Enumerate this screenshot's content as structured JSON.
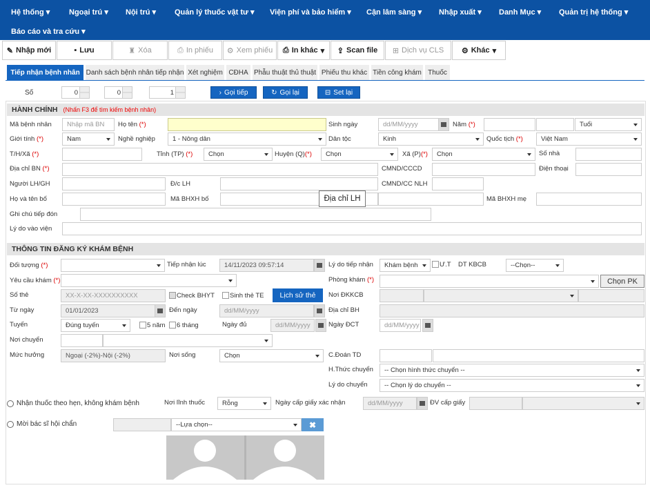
{
  "nav": {
    "row1": [
      "Hệ thống",
      "Ngoại trú",
      "Nội trú",
      "Quản lý thuốc vật tư",
      "Viện phí và bảo hiểm",
      "Cận lâm sàng",
      "Nhập xuất",
      "Danh Mục",
      "Quản trị hệ thống"
    ],
    "row2": [
      "Báo cáo và tra cứu"
    ]
  },
  "toolbar": [
    "Nhập mới",
    "Lưu",
    "Xóa",
    "In phiếu",
    "Xem phiếu",
    "In khác",
    "Scan file",
    "Dịch vụ CLS",
    "Khác"
  ],
  "tabs": [
    "Tiếp nhận bệnh nhân",
    "Danh sách bệnh nhân tiếp nhận",
    "Xét nghiệm",
    "CĐHA",
    "Phẫu thuật thủ thuật",
    "Phiếu thu khác",
    "Tiền công khám",
    "Thuốc"
  ],
  "counter": {
    "label": "Số",
    "values": [
      "0",
      "0",
      "1"
    ],
    "call_next": "Gọi tiếp",
    "recall": "Gọi lại",
    "reset": "Set lại"
  },
  "hanh_chinh": {
    "title": "HÀNH CHÍNH",
    "hint": "(Nhấn F3 để tìm kiếm bệnh nhân)",
    "ma_bn_label": "Mã bệnh nhân",
    "ma_bn_placeholder": "Nhập mã BN",
    "ho_ten_label": "Họ tên",
    "sinh_ngay_label": "Sinh ngày",
    "sinh_ngay_placeholder": "dd/MM/yyyy",
    "nam_label": "Năm",
    "tuoi_value": "Tuổi",
    "gioi_tinh_label": "Giới tính",
    "gioi_tinh_value": "Nam",
    "nghe_nghiep_label": "Nghề nghiệp",
    "nghe_nghiep_value": "1 - Nông dân",
    "dan_toc_label": "Dân tộc",
    "dan_toc_value": "Kinh",
    "quoc_tich_label": "Quốc tịch",
    "quoc_tich_value": "Việt Nam",
    "thx_label": "T/H/Xã",
    "tinh_label": "Tỉnh (TP)",
    "tinh_value": "Chọn",
    "huyen_label": "Huyện (Q)",
    "huyen_value": "Chọn",
    "xa_label": "Xã (P)",
    "xa_value": "Chọn",
    "so_nha_label": "Số nhà",
    "dia_chi_label": "Địa chỉ BN",
    "cmnd_label": "CMND/CCCD",
    "dien_thoai_label": "Điện thoại",
    "nguoi_lh_label": "Người LH/GH",
    "dc_lh_label": "Đ/c LH",
    "cmnd_nlh_label": "CMND/CC NLH",
    "ho_ten_bo_label": "Họ và tên bố",
    "ma_bhxh_bo_label": "Mã BHXH bố",
    "tooltip": "Địa chỉ LH",
    "ma_bhxh_me_label": "Mã BHXH mẹ",
    "ghi_chu_label": "Ghi chú tiếp đón",
    "ly_do_label": "Lý do vào viện"
  },
  "dang_ky": {
    "title": "THÔNG TIN ĐĂNG KÝ KHÁM BỆNH",
    "doi_tuong_label": "Đối tượng",
    "tiep_nhan_luc_label": "Tiếp nhận lúc",
    "tiep_nhan_luc_value": "14/11/2023 09:57:14",
    "ly_do_tn_label": "Lý do tiếp nhận",
    "ly_do_tn_value": "Khám bệnh",
    "ut_label": "Ư.T",
    "dt_kbcb_label": "DT KBCB",
    "dt_kbcb_value": "--Chọn--",
    "yeu_cau_label": "Yêu cầu khám",
    "phong_kham_label": "Phòng khám",
    "chon_pk": "Chọn PK",
    "so_the_label": "Số thẻ",
    "so_the_placeholder": "XX-X-XX-XXXXXXXXXX",
    "check_bhyt": "Check BHYT",
    "sinh_the_te": "Sinh thẻ TE",
    "lich_su_the": "Lịch sử thẻ",
    "noi_dkkcb_label": "Nơi ĐKKCB",
    "tu_ngay_label": "Từ ngày",
    "tu_ngay_value": "01/01/2023",
    "den_ngay_label": "Đến ngày",
    "den_ngay_placeholder": "dd/MM/yyyy",
    "dia_chi_bh_label": "Địa chỉ BH",
    "tuyen_label": "Tuyến",
    "tuyen_value": "Đúng tuyến",
    "nam5": "5 năm",
    "thang6": "6 tháng",
    "ngay_du_label": "Ngày đủ",
    "ngay_du_placeholder": "dd/MM/yyyy",
    "ngay_dct_label": "Ngày ĐCT",
    "ngay_dct_placeholder": "dd/MM/yyyy",
    "noi_chuyen_label": "Nơi chuyển",
    "muc_huong_label": "Mức hưởng",
    "muc_huong_value": "Ngoại (-2%)-Nội (-2%)",
    "noi_song_label": "Nơi sống",
    "noi_song_value": "Chọn",
    "cdoan_label": "C.Đoán TD",
    "hthuc_label": "H.Thức chuyển",
    "hthuc_value": "-- Chọn hình thức chuyển --",
    "ly_do_chuyen_label": "Lý do chuyển",
    "ly_do_chuyen_value": "-- Chọn lý do chuyển --",
    "nhan_thuoc_label": "Nhận thuốc theo hẹn, không khám bệnh",
    "noi_linh_label": "Nơi lĩnh thuốc",
    "noi_linh_value": "Rỗng",
    "ngay_cap_label": "Ngày cấp giấy xác nhận",
    "ngay_cap_placeholder": "dd/MM/yyyy",
    "dv_cap_label": "ĐV cấp giấy",
    "moi_bs_label": "Mời bác sĩ hội chẩn",
    "lua_chon_value": "--Lựa chọn--"
  }
}
